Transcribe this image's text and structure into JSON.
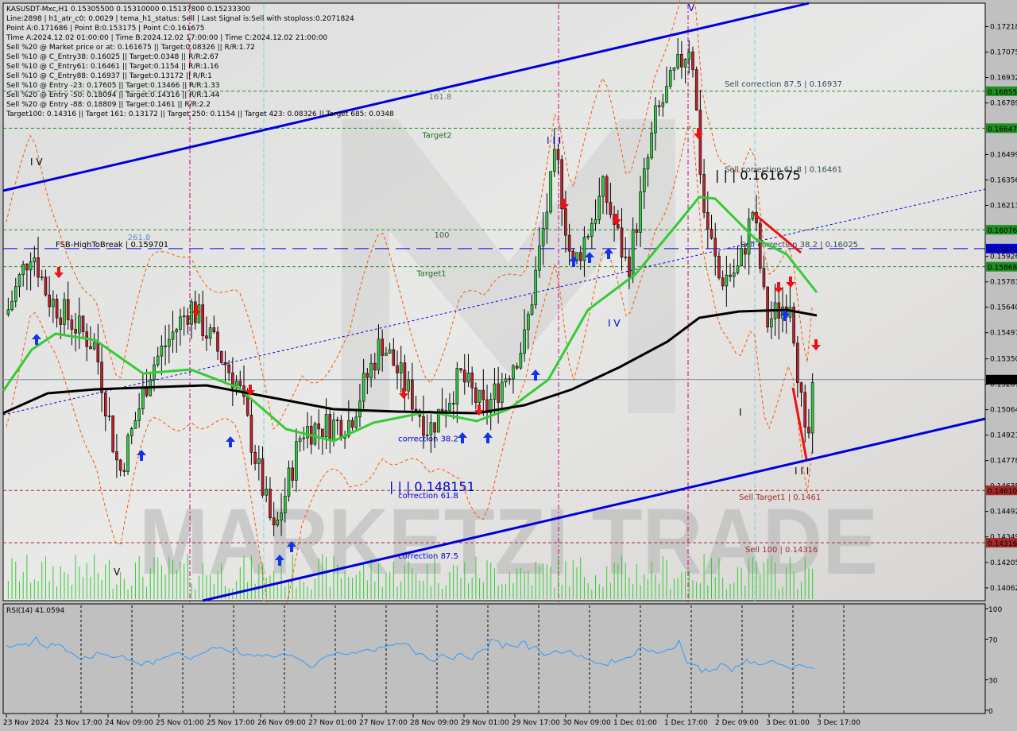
{
  "chart_data": {
    "type": "candlestick",
    "symbol": "KASUSDT-Mxc",
    "timeframe": "H1",
    "ohlc_header": "KASUSDT-Mxc,H1  0.15305500 0.15310000 0.15137800 0.15233300",
    "info_lines": [
      "Line:2898 | h1_atr_c0: 0.0029 | tema_h1_status: Sell | Last Signal is:Sell with stoploss:0.2071824",
      "Point A:0.171686 | Point B:0.153175 | Point C:0.161675",
      "Time A:2024.12.02 01:00:00 | Time B:2024.12.02 17:00:00 | Time C:2024.12.02 21:00:00",
      "Sell %20 @ Market price or at: 0.161675 || Target:0.08326 || R/R:1.72",
      "Sell %10 @ C_Entry38: 0.16025 || Target:0.0348 || R/R:2.67",
      "Sell %10 @ C_Entry61: 0.16461 || Target:0.1154 || R/R:1.16",
      "Sell %10 @ C_Entry88: 0.16937 || Target:0.13172 || R/R:1",
      "Sell %10 @ Entry -23: 0.17605 || Target:0.13466 || R/R:1.33",
      "Sell %20 @ Entry -50: 0.18094 || Target:0.14316 || R/R:1.44",
      "Sell %20 @ Entry -88: 0.18809 || Target:0.1461 || R/R:2.2",
      "Target100: 0.14316 || Target 161: 0.13172 || Target 250: 0.1154 || Target 423: 0.08326 || Target 685: 0.0348"
    ],
    "y_axis": {
      "range": [
        0.1399,
        0.1735
      ],
      "ticks": [
        "0.17218",
        "0.17075",
        "0.16932",
        "0.16789",
        "0.16499",
        "0.16356",
        "0.16213",
        "0.15926",
        "0.15783",
        "0.15640",
        "0.15497",
        "0.15350",
        "0.15207",
        "0.15064",
        "0.14921",
        "0.14778",
        "0.14635",
        "0.14492",
        "0.14349",
        "0.14205",
        "0.14062"
      ]
    },
    "price_badges": [
      {
        "value": "0.16855",
        "price": 0.16855,
        "color": "#1f8f1f"
      },
      {
        "value": "0.16647",
        "price": 0.16647,
        "color": "#1f8f1f"
      },
      {
        "value": "0.16076",
        "price": 0.16076,
        "color": "#1f8f1f"
      },
      {
        "value": "0.15970",
        "price": 0.1597,
        "color": "#0000e0"
      },
      {
        "value": "0.15868",
        "price": 0.15868,
        "color": "#1f8f1f"
      },
      {
        "value": "0.15233",
        "price": 0.15233,
        "color": "#000000"
      },
      {
        "value": "0.14610",
        "price": 0.1461,
        "color": "#a52a2a"
      },
      {
        "value": "0.14316",
        "price": 0.14316,
        "color": "#a52a2a"
      }
    ],
    "x_axis": {
      "ticks": [
        "23 Nov 2024",
        "23 Nov 17:00",
        "24 Nov 09:00",
        "25 Nov 01:00",
        "25 Nov 17:00",
        "26 Nov 09:00",
        "27 Nov 01:00",
        "27 Nov 17:00",
        "28 Nov 09:00",
        "29 Nov 01:00",
        "29 Nov 17:00",
        "30 Nov 09:00",
        "1 Dec 01:00",
        "1 Dec 17:00",
        "2 Dec 09:00",
        "3 Dec 01:00",
        "3 Dec 17:00"
      ]
    },
    "levels": [
      {
        "label": "Sell correction 87.5 | 0.16937",
        "price": 0.16855,
        "style": "green-dash",
        "label_side": "right"
      },
      {
        "label": "161.8",
        "price": 0.16855,
        "style": "label-only",
        "label_side": "left"
      },
      {
        "label": "Sell correction 61.8 | 0.16461",
        "price": 0.16647,
        "style": "green-dash",
        "label_side": "right-low"
      },
      {
        "label": "Target2",
        "price": 0.16647,
        "style": "label-only",
        "label_side": "left"
      },
      {
        "label": "100",
        "price": 0.16076,
        "style": "green-dash",
        "label_side": "left"
      },
      {
        "label": "Sell correction 38.2 | 0.16025",
        "price": 0.1597,
        "style": "blue-longdash",
        "label_side": "right"
      },
      {
        "label": "FSB-HighToBreak | 0.159701",
        "price": 0.1597,
        "style": "label-only",
        "label_side": "far-left"
      },
      {
        "label": "261.8",
        "price": 0.1597,
        "style": "label-only",
        "label_side": "far-left-top"
      },
      {
        "label": "Target1",
        "price": 0.15868,
        "style": "green-dash",
        "label_side": "left"
      },
      {
        "label": "Sell Target1 | 0.1461",
        "price": 0.1461,
        "style": "red-dash",
        "label_side": "right"
      },
      {
        "label": "correction 61.8",
        "price": 0.1461,
        "style": "label-only",
        "label_side": "mid"
      },
      {
        "label": "Sell 100 | 0.14316",
        "price": 0.14316,
        "style": "red-dash",
        "label_side": "right"
      },
      {
        "label": "correction 87.5",
        "price": 0.14316,
        "style": "label-only",
        "label_side": "mid"
      },
      {
        "label": "correction 38.2",
        "price": 0.149,
        "style": "label-only",
        "label_side": "mid"
      }
    ],
    "annotations": [
      {
        "text": "| | | 0.161675",
        "color": "#000000"
      },
      {
        "text": "| | | 0.148151",
        "color": "#0000cc"
      },
      {
        "text": "I V",
        "color": "#000000"
      },
      {
        "text": "I I I",
        "color": "#0000cc"
      },
      {
        "text": "I V",
        "color": "#0000cc"
      },
      {
        "text": "V",
        "color": "#0000cc"
      },
      {
        "text": "V",
        "color": "#000000"
      },
      {
        "text": "I I I",
        "color": "#000000"
      },
      {
        "text": "I",
        "color": "#000000"
      }
    ],
    "current_price": 0.15233,
    "watermark": "MARKETZI TRADE",
    "rsi": {
      "label": "RSI(14) 41.0594",
      "value": 41.0594,
      "range": [
        0,
        100
      ],
      "ticks": [
        "100",
        "70",
        "30",
        "0"
      ],
      "values": [
        64,
        62,
        63,
        65,
        64,
        66,
        63,
        68,
        72,
        65,
        63,
        61,
        66,
        64,
        65,
        63,
        58,
        57,
        55,
        52,
        50,
        53,
        51,
        52,
        57,
        56,
        55,
        54,
        52,
        52,
        53,
        54,
        50,
        49,
        48,
        46,
        44,
        48,
        48,
        45,
        50,
        50,
        52,
        53,
        55,
        56,
        57,
        54,
        52,
        50,
        53,
        54,
        56,
        57,
        60,
        62,
        61,
        62,
        60,
        58,
        57,
        62,
        56,
        54,
        55,
        55,
        53,
        55,
        53,
        55,
        54,
        52,
        53,
        55,
        56,
        54,
        54,
        52,
        50,
        48,
        45,
        42,
        43,
        48,
        51,
        53,
        54,
        55,
        57,
        56,
        55,
        55,
        57,
        56,
        58,
        59,
        60,
        59,
        58,
        62,
        62,
        63,
        64,
        64,
        66,
        65,
        66,
        65,
        60,
        55,
        56,
        55,
        51,
        49,
        48,
        53,
        55,
        53,
        51,
        50,
        55,
        56,
        53,
        51,
        50,
        56,
        58,
        60,
        60,
        70,
        69,
        68,
        61,
        66,
        64,
        63,
        62,
        67,
        68,
        60,
        62,
        63,
        58,
        54,
        55,
        56,
        59,
        57,
        56,
        58,
        59,
        55,
        53,
        54,
        51,
        50,
        48,
        46,
        46,
        45,
        44,
        50,
        47,
        49,
        50,
        52,
        52,
        54,
        60,
        62,
        60,
        58,
        59,
        56,
        57,
        58,
        60,
        60,
        62,
        69,
        58,
        47,
        46,
        45,
        44,
        37,
        41,
        38,
        40,
        40,
        46,
        45,
        43,
        38,
        43,
        44,
        46,
        50,
        46,
        48,
        45,
        45,
        46,
        48,
        49,
        46,
        45,
        44,
        42,
        40,
        44,
        45,
        44,
        42,
        42,
        41
      ]
    }
  },
  "series_style": {
    "up_color": "#2ecc40",
    "down_color": "#c0202a",
    "ma_fast_color": "#33cc33",
    "ma_slow_color": "#000000",
    "channel_color": "#0000dd",
    "envelope_color": "#ff5500",
    "rsi_color": "#3399ff",
    "volume_color": "#33cc33"
  }
}
